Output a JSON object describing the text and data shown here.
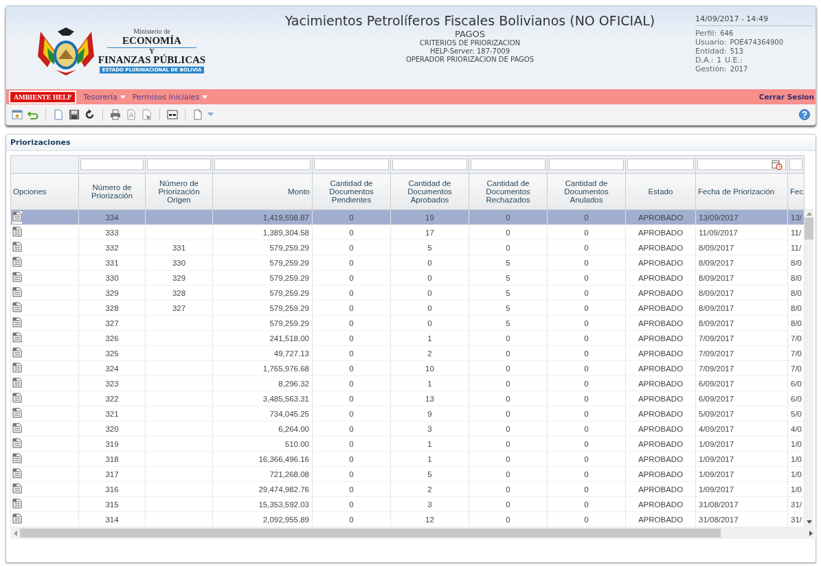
{
  "header": {
    "ministry": {
      "top": "Ministerio de",
      "line1": "ECONOMÍA",
      "joiner": "Y",
      "line2": "FINANZAS PÚBLICAS",
      "band": "ESTADO PLURINACIONAL DE BOLIVIA"
    },
    "title": "Yacimientos Petrolíferos Fiscales Bolivianos (NO OFICIAL)",
    "module": "PAGOS",
    "subtitles": [
      "CRITERIOS DE PRIORIZACION",
      "HELP-Server: 187-7009",
      "OPERADOR PRIORIZACION DE PAGOS"
    ],
    "session": {
      "datetime": "14/09/2017 - 14:49",
      "lines": [
        [
          {
            "label": "Perfil:",
            "value": "646"
          }
        ],
        [
          {
            "label": "Usuario:",
            "value": "POE474364900"
          }
        ],
        [
          {
            "label": "Entidad:",
            "value": "513"
          }
        ],
        [
          {
            "label": "D.A.:",
            "value": "1"
          },
          {
            "label": "U.E.:"
          }
        ],
        [
          {
            "label": "Gestión:",
            "value": "2017"
          }
        ]
      ]
    }
  },
  "menu": {
    "environment": "AMBIENTE HELP",
    "items": [
      {
        "label": "Tesorería"
      },
      {
        "label": "Permisos Iniciales"
      }
    ],
    "logout": "Cerrar Sesion"
  },
  "panel": {
    "title": "Priorizaciones",
    "table": {
      "columns": [
        {
          "label": "Opciones",
          "filter": false
        },
        {
          "label": "Número de Priorización",
          "filter": true
        },
        {
          "label": "Número de Priorización Origen",
          "filter": true
        },
        {
          "label": "Monto",
          "filter": true
        },
        {
          "label": "Cantidad de Documentos Pendientes",
          "filter": true
        },
        {
          "label": "Cantidad de Documentos Aprobados",
          "filter": true
        },
        {
          "label": "Cantidad de Documentos Rechazados",
          "filter": true
        },
        {
          "label": "Cantidad de Documentos Anulados",
          "filter": true
        },
        {
          "label": "Estado",
          "filter": true
        },
        {
          "label": "Fecha de Priorización",
          "filter": true,
          "date_picker": true
        },
        {
          "label": "Fec",
          "filter": true
        }
      ],
      "rows": [
        {
          "selected": true,
          "cells": [
            "",
            "334",
            "",
            "1,419,598.87",
            "0",
            "19",
            "0",
            "0",
            "APROBADO",
            "13/09/2017",
            "13/"
          ]
        },
        {
          "selected": false,
          "cells": [
            "",
            "333",
            "",
            "1,389,304.58",
            "0",
            "17",
            "0",
            "0",
            "APROBADO",
            "11/09/2017",
            "11/"
          ]
        },
        {
          "selected": false,
          "cells": [
            "",
            "332",
            "331",
            "579,259.29",
            "0",
            "5",
            "0",
            "0",
            "APROBADO",
            "8/09/2017",
            "11/"
          ]
        },
        {
          "selected": false,
          "cells": [
            "",
            "331",
            "330",
            "579,259.29",
            "0",
            "0",
            "5",
            "0",
            "APROBADO",
            "8/09/2017",
            "8/0"
          ]
        },
        {
          "selected": false,
          "cells": [
            "",
            "330",
            "329",
            "579,259.29",
            "0",
            "0",
            "5",
            "0",
            "APROBADO",
            "8/09/2017",
            "8/0"
          ]
        },
        {
          "selected": false,
          "cells": [
            "",
            "329",
            "328",
            "579,259.29",
            "0",
            "0",
            "5",
            "0",
            "APROBADO",
            "8/09/2017",
            "8/0"
          ]
        },
        {
          "selected": false,
          "cells": [
            "",
            "328",
            "327",
            "579,259.29",
            "0",
            "0",
            "5",
            "0",
            "APROBADO",
            "8/09/2017",
            "8/0"
          ]
        },
        {
          "selected": false,
          "cells": [
            "",
            "327",
            "",
            "579,259.29",
            "0",
            "0",
            "5",
            "0",
            "APROBADO",
            "8/09/2017",
            "8/0"
          ]
        },
        {
          "selected": false,
          "cells": [
            "",
            "326",
            "",
            "241,518.00",
            "0",
            "1",
            "0",
            "0",
            "APROBADO",
            "7/09/2017",
            "7/0"
          ]
        },
        {
          "selected": false,
          "cells": [
            "",
            "325",
            "",
            "49,727.13",
            "0",
            "2",
            "0",
            "0",
            "APROBADO",
            "7/09/2017",
            "7/0"
          ]
        },
        {
          "selected": false,
          "cells": [
            "",
            "324",
            "",
            "1,765,976.68",
            "0",
            "10",
            "0",
            "0",
            "APROBADO",
            "7/09/2017",
            "7/0"
          ]
        },
        {
          "selected": false,
          "cells": [
            "",
            "323",
            "",
            "8,296.32",
            "0",
            "1",
            "0",
            "0",
            "APROBADO",
            "6/09/2017",
            "6/0"
          ]
        },
        {
          "selected": false,
          "cells": [
            "",
            "322",
            "",
            "3,485,563.31",
            "0",
            "13",
            "0",
            "0",
            "APROBADO",
            "6/09/2017",
            "6/0"
          ]
        },
        {
          "selected": false,
          "cells": [
            "",
            "321",
            "",
            "734,045.25",
            "0",
            "9",
            "0",
            "0",
            "APROBADO",
            "5/09/2017",
            "5/0"
          ]
        },
        {
          "selected": false,
          "cells": [
            "",
            "320",
            "",
            "6,264.00",
            "0",
            "3",
            "0",
            "0",
            "APROBADO",
            "4/09/2017",
            "4/0"
          ]
        },
        {
          "selected": false,
          "cells": [
            "",
            "319",
            "",
            "510.00",
            "0",
            "1",
            "0",
            "0",
            "APROBADO",
            "1/09/2017",
            "1/0"
          ]
        },
        {
          "selected": false,
          "cells": [
            "",
            "318",
            "",
            "16,366,496.16",
            "0",
            "1",
            "0",
            "0",
            "APROBADO",
            "1/09/2017",
            "1/0"
          ]
        },
        {
          "selected": false,
          "cells": [
            "",
            "317",
            "",
            "721,268.08",
            "0",
            "5",
            "0",
            "0",
            "APROBADO",
            "1/09/2017",
            "1/0"
          ]
        },
        {
          "selected": false,
          "cells": [
            "",
            "316",
            "",
            "29,474,982.76",
            "0",
            "2",
            "0",
            "0",
            "APROBADO",
            "1/09/2017",
            "1/0"
          ]
        },
        {
          "selected": false,
          "cells": [
            "",
            "315",
            "",
            "15,353,592.03",
            "0",
            "3",
            "0",
            "0",
            "APROBADO",
            "31/08/2017",
            "31/"
          ]
        },
        {
          "selected": false,
          "cells": [
            "",
            "314",
            "",
            "2,092,955.89",
            "0",
            "12",
            "0",
            "0",
            "APROBADO",
            "31/08/2017",
            "31/"
          ]
        }
      ]
    }
  }
}
